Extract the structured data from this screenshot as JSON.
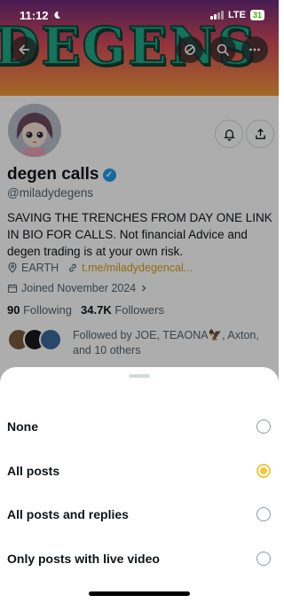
{
  "status_bar": {
    "time": "11:12",
    "network": "LTE",
    "battery": "31"
  },
  "banner": {
    "text": "DEGENS"
  },
  "profile": {
    "display_name": "degen calls",
    "handle": "@miladydegens",
    "bio": "SAVING THE TRENCHES FROM DAY ONE LINK IN BIO FOR CALLS. Not financial Advice and degen trading is at your own risk.",
    "location": "EARTH",
    "link": "t.me/miladydegencal...",
    "joined": "Joined November 2024",
    "following_count": "90",
    "following_label": "Following",
    "followers_count": "34.7K",
    "followers_label": "Followers",
    "followed_by": "Followed by JOE, TEAONA🦅, Axton, and 10 others"
  },
  "sheet": {
    "options": [
      {
        "label": "None",
        "selected": false
      },
      {
        "label": "All posts",
        "selected": true
      },
      {
        "label": "All posts and replies",
        "selected": false
      },
      {
        "label": "Only posts with live video",
        "selected": false
      }
    ]
  },
  "icons": [
    "back-arrow-icon",
    "repost-icon",
    "search-icon",
    "more-icon",
    "bell-icon",
    "share-icon",
    "location-icon",
    "link-icon",
    "calendar-icon",
    "verified-icon",
    "moon-icon"
  ],
  "colors": {
    "accent_radio": "#f4c542",
    "verified": "#1d9bf0",
    "link": "#d4a017"
  }
}
